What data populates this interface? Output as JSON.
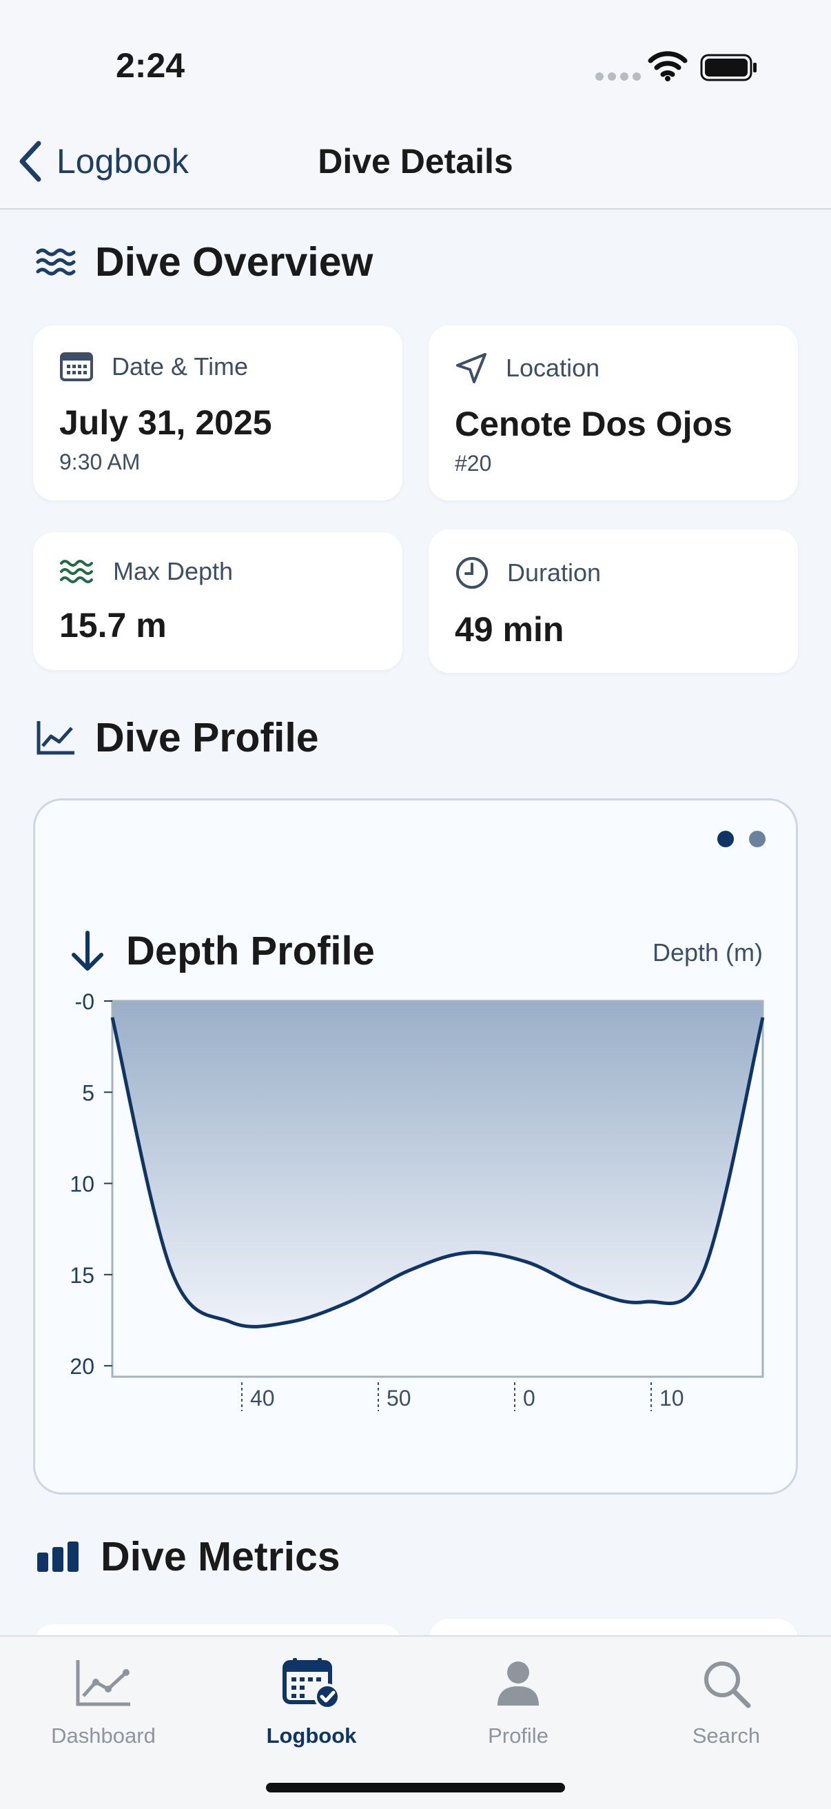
{
  "status": {
    "time": "2:24"
  },
  "nav": {
    "back_label": "Logbook",
    "title": "Dive Details"
  },
  "overview": {
    "title": "Dive Overview",
    "cards": {
      "datetime": {
        "label": "Date & Time",
        "value": "July 31, 2025",
        "sub": "9:30 AM",
        "icon": "calendar-icon"
      },
      "location": {
        "label": "Location",
        "value": "Cenote Dos Ojos",
        "sub": "#20",
        "icon": "location-arrow-icon"
      },
      "max_depth": {
        "label": "Max Depth",
        "value": "15.7 m",
        "icon": "waves-icon",
        "icon_color": "#1f6b45"
      },
      "duration": {
        "label": "Duration",
        "value": "49 min",
        "icon": "clock-icon"
      }
    }
  },
  "profile": {
    "title": "Dive Profile",
    "pages": 2,
    "current_page": 1
  },
  "chart_data": {
    "type": "area",
    "title": "Depth Profile",
    "unit_label": "Depth (m)",
    "y_ticks": [
      "-0",
      "5",
      "10",
      "15",
      "20"
    ],
    "y_range": [
      0,
      20.6
    ],
    "y_inverted": true,
    "x_tick_labels": [
      "40",
      "50",
      "0",
      "10"
    ],
    "depth": [
      0.9,
      14.8,
      17.6,
      17.6,
      16.5,
      14.8,
      13.8,
      14.3,
      15.8,
      16.5,
      14.8,
      0.9
    ],
    "fill_color": "#9aafc8",
    "line_color": "#0f3566"
  },
  "metrics": {
    "title": "Dive Metrics"
  },
  "tabs": [
    {
      "label": "Dashboard",
      "icon": "chart-line-icon",
      "active": false
    },
    {
      "label": "Logbook",
      "icon": "calendar-check-icon",
      "active": true
    },
    {
      "label": "Profile",
      "icon": "person-icon",
      "active": false
    },
    {
      "label": "Search",
      "icon": "search-icon",
      "active": false
    }
  ],
  "colors": {
    "accent": "#0f3566",
    "inactive": "#8f959d",
    "background": "#f3f7fc"
  }
}
